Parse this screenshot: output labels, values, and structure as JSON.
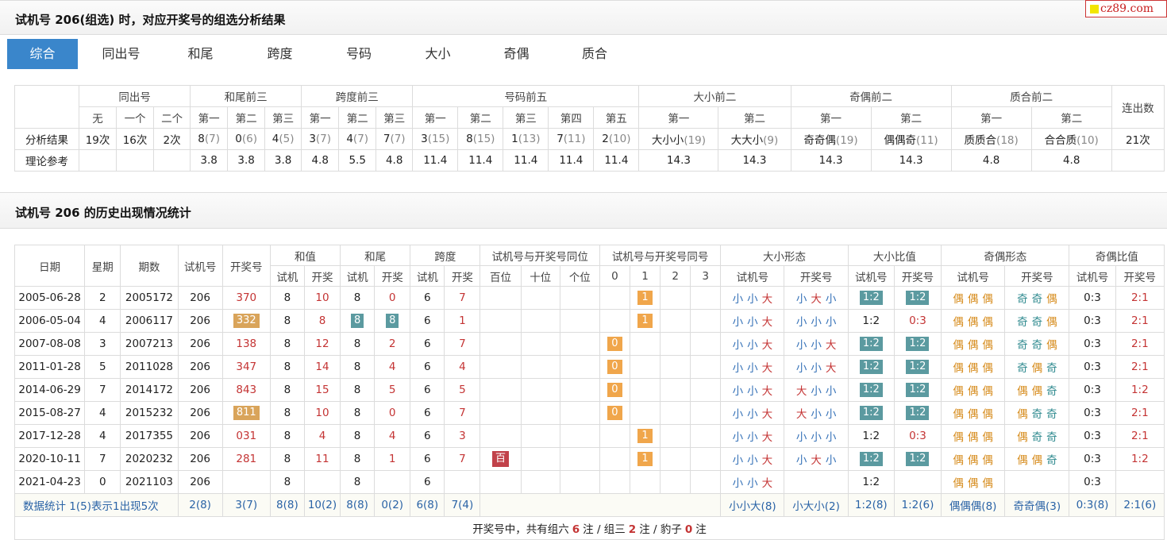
{
  "title1": "试机号 206(组选) 时，对应开奖号的组选分析结果",
  "title2": "试机号 206 的历史出现情况统计",
  "logo": "cz89.com",
  "tabs": [
    "综合",
    "同出号",
    "和尾",
    "跨度",
    "号码",
    "大小",
    "奇偶",
    "质合"
  ],
  "analysis": {
    "groups": [
      "同出号",
      "和尾前三",
      "跨度前三",
      "号码前五",
      "大小前二",
      "奇偶前二",
      "质合前二",
      "连出数"
    ],
    "subheads": [
      "无",
      "一个",
      "二个",
      "第一",
      "第二",
      "第三",
      "第一",
      "第二",
      "第三",
      "第一",
      "第二",
      "第三",
      "第四",
      "第五",
      "第一",
      "第二",
      "第一",
      "第二",
      "第一",
      "第二"
    ],
    "result_label": "分析结果",
    "results": [
      {
        "v": "19次"
      },
      {
        "v": "16次"
      },
      {
        "v": "2次"
      },
      {
        "v": "8",
        "s": "(7)"
      },
      {
        "v": "0",
        "s": "(6)"
      },
      {
        "v": "4",
        "s": "(5)"
      },
      {
        "v": "3",
        "s": "(7)"
      },
      {
        "v": "4",
        "s": "(7)"
      },
      {
        "v": "7",
        "s": "(7)"
      },
      {
        "v": "3",
        "s": "(15)"
      },
      {
        "v": "8",
        "s": "(15)"
      },
      {
        "v": "1",
        "s": "(13)"
      },
      {
        "v": "7",
        "s": "(11)"
      },
      {
        "v": "2",
        "s": "(10)"
      },
      {
        "v": "大小小",
        "s": "(19)"
      },
      {
        "v": "大大小",
        "s": "(9)"
      },
      {
        "v": "奇奇偶",
        "s": "(19)"
      },
      {
        "v": "偶偶奇",
        "s": "(11)"
      },
      {
        "v": "质质合",
        "s": "(18)"
      },
      {
        "v": "合合质",
        "s": "(10)"
      },
      {
        "v": "21次"
      }
    ],
    "ref_label": "理论参考",
    "refs": [
      "",
      "",
      "",
      "3.8",
      "3.8",
      "3.8",
      "4.8",
      "5.5",
      "4.8",
      "11.4",
      "11.4",
      "11.4",
      "11.4",
      "11.4",
      "14.3",
      "14.3",
      "14.3",
      "14.3",
      "4.8",
      "4.8",
      ""
    ]
  },
  "history": {
    "head1": [
      "日期",
      "星期",
      "期数",
      "试机号",
      "开奖号",
      "和值",
      "和尾",
      "跨度",
      "试机号与开奖号同位",
      "试机号与开奖号同号",
      "大小形态",
      "大小比值",
      "奇偶形态",
      "奇偶比值"
    ],
    "head2": [
      "试机",
      "开奖",
      "试机",
      "开奖",
      "试机",
      "开奖",
      "百位",
      "十位",
      "个位",
      "0",
      "1",
      "2",
      "3",
      "试机号",
      "开奖号",
      "试机号",
      "开奖号",
      "试机号",
      "开奖号",
      "试机号",
      "开奖号"
    ],
    "rows": [
      {
        "date": "2005-06-28",
        "wd": "2",
        "no": "2005172",
        "sj": "206",
        "kj": "370",
        "kjb": "",
        "hs": "8",
        "hk": "10",
        "ws": "8",
        "wk": "0",
        "wb": "",
        "ks": "6",
        "kk": "7",
        "pos": "",
        "same": "1",
        "dxs": "小 小 大",
        "dxk": "小 大 小",
        "dbs": "1:2",
        "dbk": "1:2",
        "dbb": "b",
        "jos": "偶 偶 偶",
        "jok": "奇 奇 偶",
        "jbs": "0:3",
        "jbk": "2:1"
      },
      {
        "date": "2006-05-04",
        "wd": "4",
        "no": "2006117",
        "sj": "206",
        "kj": "332",
        "kjb": "g",
        "hs": "8",
        "hk": "8",
        "ws": "8",
        "wk": "8",
        "wb": "b",
        "ks": "6",
        "kk": "1",
        "pos": "",
        "same": "1",
        "dxs": "小 小 大",
        "dxk": "小 小 小",
        "dbs": "1:2",
        "dbk": "0:3",
        "dbb": "",
        "jos": "偶 偶 偶",
        "jok": "奇 奇 偶",
        "jbs": "0:3",
        "jbk": "2:1"
      },
      {
        "date": "2007-08-08",
        "wd": "3",
        "no": "2007213",
        "sj": "206",
        "kj": "138",
        "kjb": "",
        "hs": "8",
        "hk": "12",
        "ws": "8",
        "wk": "2",
        "wb": "",
        "ks": "6",
        "kk": "7",
        "pos": "",
        "same": "0",
        "dxs": "小 小 大",
        "dxk": "小 小 大",
        "dbs": "1:2",
        "dbk": "1:2",
        "dbb": "b",
        "jos": "偶 偶 偶",
        "jok": "奇 奇 偶",
        "jbs": "0:3",
        "jbk": "2:1"
      },
      {
        "date": "2011-01-28",
        "wd": "5",
        "no": "2011028",
        "sj": "206",
        "kj": "347",
        "kjb": "",
        "hs": "8",
        "hk": "14",
        "ws": "8",
        "wk": "4",
        "wb": "",
        "ks": "6",
        "kk": "4",
        "pos": "",
        "same": "0",
        "dxs": "小 小 大",
        "dxk": "小 小 大",
        "dbs": "1:2",
        "dbk": "1:2",
        "dbb": "b",
        "jos": "偶 偶 偶",
        "jok": "奇 偶 奇",
        "jbs": "0:3",
        "jbk": "2:1"
      },
      {
        "date": "2014-06-29",
        "wd": "7",
        "no": "2014172",
        "sj": "206",
        "kj": "843",
        "kjb": "",
        "hs": "8",
        "hk": "15",
        "ws": "8",
        "wk": "5",
        "wb": "",
        "ks": "6",
        "kk": "5",
        "pos": "",
        "same": "0",
        "dxs": "小 小 大",
        "dxk": "大 小 小",
        "dbs": "1:2",
        "dbk": "1:2",
        "dbb": "b",
        "jos": "偶 偶 偶",
        "jok": "偶 偶 奇",
        "jbs": "0:3",
        "jbk": "1:2"
      },
      {
        "date": "2015-08-27",
        "wd": "4",
        "no": "2015232",
        "sj": "206",
        "kj": "811",
        "kjb": "g",
        "hs": "8",
        "hk": "10",
        "ws": "8",
        "wk": "0",
        "wb": "",
        "ks": "6",
        "kk": "7",
        "pos": "",
        "same": "0",
        "dxs": "小 小 大",
        "dxk": "大 小 小",
        "dbs": "1:2",
        "dbk": "1:2",
        "dbb": "b",
        "jos": "偶 偶 偶",
        "jok": "偶 奇 奇",
        "jbs": "0:3",
        "jbk": "2:1"
      },
      {
        "date": "2017-12-28",
        "wd": "4",
        "no": "2017355",
        "sj": "206",
        "kj": "031",
        "kjb": "",
        "hs": "8",
        "hk": "4",
        "ws": "8",
        "wk": "4",
        "wb": "",
        "ks": "6",
        "kk": "3",
        "pos": "",
        "same": "1",
        "dxs": "小 小 大",
        "dxk": "小 小 小",
        "dbs": "1:2",
        "dbk": "0:3",
        "dbb": "",
        "jos": "偶 偶 偶",
        "jok": "偶 奇 奇",
        "jbs": "0:3",
        "jbk": "2:1"
      },
      {
        "date": "2020-10-11",
        "wd": "7",
        "no": "2020232",
        "sj": "206",
        "kj": "281",
        "kjb": "",
        "hs": "8",
        "hk": "11",
        "ws": "8",
        "wk": "1",
        "wb": "",
        "ks": "6",
        "kk": "7",
        "pos": "百",
        "same": "1",
        "dxs": "小 小 大",
        "dxk": "小 大 小",
        "dbs": "1:2",
        "dbk": "1:2",
        "dbb": "b",
        "jos": "偶 偶 偶",
        "jok": "偶 偶 奇",
        "jbs": "0:3",
        "jbk": "1:2"
      },
      {
        "date": "2021-04-23",
        "wd": "0",
        "no": "2021103",
        "sj": "206",
        "kj": "",
        "kjb": "",
        "hs": "8",
        "hk": "",
        "ws": "8",
        "wk": "",
        "wb": "",
        "ks": "6",
        "kk": "",
        "pos": "",
        "same": "",
        "dxs": "小 小 大",
        "dxk": "",
        "dbs": "1:2",
        "dbk": "",
        "dbb": "",
        "jos": "偶 偶 偶",
        "jok": "",
        "jbs": "0:3",
        "jbk": ""
      }
    ],
    "stats": {
      "label": "数据统计",
      "note": "1(5)表示1出现5次",
      "cells": [
        "2(8)",
        "3(7)",
        "8(8)",
        "10(2)",
        "8(8)",
        "0(2)",
        "6(8)",
        "7(4)",
        "小小大(8)",
        "小大小(2)",
        "1:2(8)",
        "1:2(6)",
        "偶偶偶(8)",
        "奇奇偶(3)",
        "0:3(8)",
        "2:1(6)"
      ]
    },
    "summary": {
      "prefix": "开奖号中，共有组六",
      "six": "6",
      "mid1": "注 / 组三",
      "three": "2",
      "mid2": "注 / 豹子",
      "leopard": "0",
      "suffix": "注"
    }
  }
}
